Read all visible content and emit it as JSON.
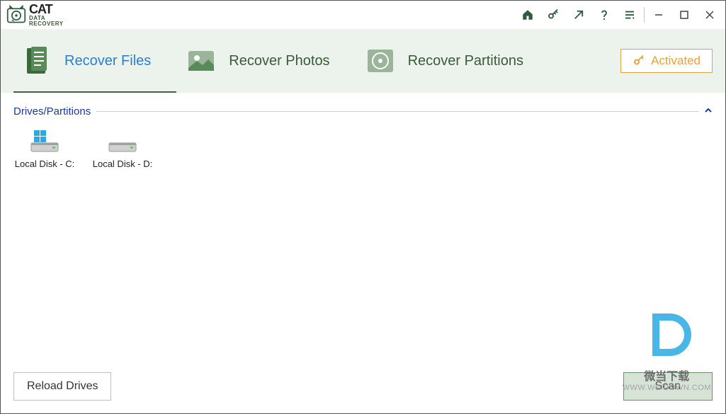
{
  "app": {
    "brand_main": "CAT",
    "brand_sub1": "DATA",
    "brand_sub2": "RECOVERY"
  },
  "tabs": {
    "files": "Recover Files",
    "photos": "Recover Photos",
    "partitions": "Recover Partitions"
  },
  "activated": {
    "label": "Activated"
  },
  "section": {
    "title": "Drives/Partitions"
  },
  "drives": [
    {
      "label": "Local Disk - C:"
    },
    {
      "label": "Local Disk - D:"
    }
  ],
  "buttons": {
    "reload": "Reload Drives",
    "scan": "Scan"
  },
  "watermark": {
    "text": "微当下载",
    "url": "WWW.WEIDOWN.COM"
  },
  "colors": {
    "accent_green": "#3a6a3a",
    "accent_blue": "#2a7fd4",
    "badge_orange": "#e6a23c"
  }
}
